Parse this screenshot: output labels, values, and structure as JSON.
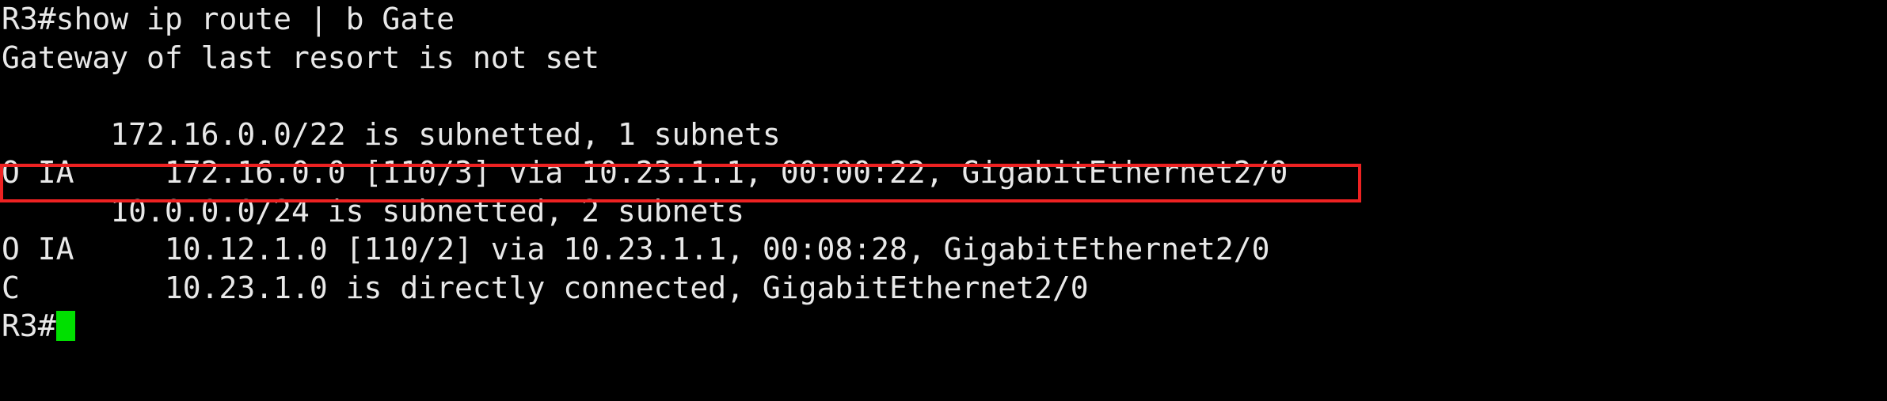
{
  "terminal": {
    "prompt": "R3#",
    "background_color": "#000000",
    "text_color": "#e8e8e8",
    "cursor_color": "#00e000",
    "highlight_color": "#ee2222",
    "lines": [
      {
        "id": "command",
        "text": "R3#show ip route | b Gate"
      },
      {
        "id": "gateway-status",
        "text": "Gateway of last resort is not set"
      },
      {
        "id": "blank-1",
        "text": ""
      },
      {
        "id": "subnet-header-172",
        "text": "      172.16.0.0/22 is subnetted, 1 subnets"
      },
      {
        "id": "route-172-16-0-0",
        "text": "O IA     172.16.0.0 [110/3] via 10.23.1.1, 00:00:22, GigabitEthernet2/0"
      },
      {
        "id": "subnet-header-10",
        "text": "      10.0.0.0/24 is subnetted, 2 subnets"
      },
      {
        "id": "route-10-12-1-0",
        "text": "O IA     10.12.1.0 [110/2] via 10.23.1.1, 00:08:28, GigabitEthernet2/0"
      },
      {
        "id": "route-10-23-1-0",
        "text": "C        10.23.1.0 is directly connected, GigabitEthernet2/0"
      },
      {
        "id": "final-prompt",
        "text": "R3#"
      }
    ],
    "highlighted_line_id": "route-172-16-0-0",
    "highlighted_line_text": "O IA     172.16.0.0 [110/3] via 10.23.1.1, 00:00:22, GigabitEthernet2/0"
  },
  "routing_table": {
    "command": "show ip route | b Gate",
    "gateway_of_last_resort": "not set",
    "device_hostname": "R3",
    "groups": [
      {
        "network": "172.16.0.0/22",
        "subnetted_text": "is subnetted, 1 subnets",
        "subnet_count": "1",
        "routes": [
          {
            "code": "O IA",
            "prefix": "172.16.0.0",
            "metric": "[110/3]",
            "via": "10.23.1.1",
            "uptime": "00:00:22",
            "interface": "GigabitEthernet2/0"
          }
        ]
      },
      {
        "network": "10.0.0.0/24",
        "subnetted_text": "is subnetted, 2 subnets",
        "subnet_count": "2",
        "routes": [
          {
            "code": "O IA",
            "prefix": "10.12.1.0",
            "metric": "[110/2]",
            "via": "10.23.1.1",
            "uptime": "00:08:28",
            "interface": "GigabitEthernet2/0"
          },
          {
            "code": "C",
            "prefix": "10.23.1.0",
            "metric": "",
            "via": "directly connected",
            "uptime": "",
            "interface": "GigabitEthernet2/0"
          }
        ]
      }
    ]
  }
}
